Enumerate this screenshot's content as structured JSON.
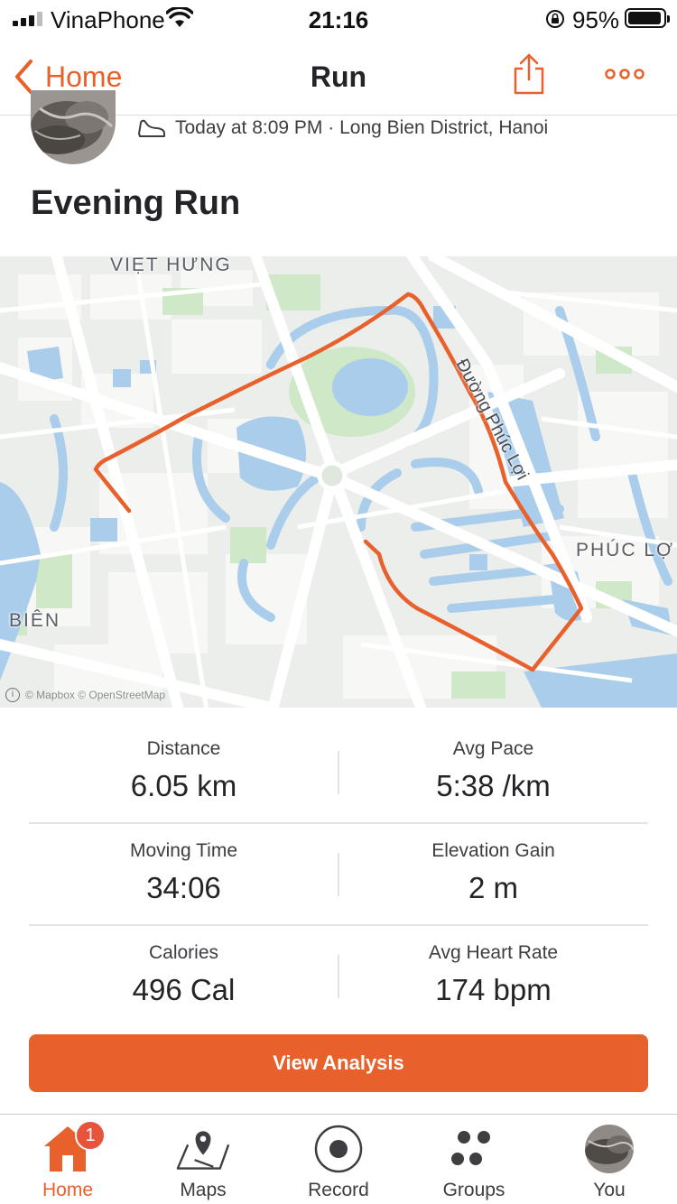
{
  "status_bar": {
    "carrier": "VinaPhone",
    "time": "21:16",
    "battery": "95%",
    "battery_level": 0.95
  },
  "nav": {
    "back_label": "Home",
    "title": "Run"
  },
  "activity": {
    "meta": "Today at 8:09 PM · Long Bien District, Hanoi",
    "title": "Evening Run"
  },
  "map": {
    "labels": {
      "viet_hung": "VIỆT HƯNG",
      "phuc_loi": "PHÚC LỢ",
      "bien": "BIÊN",
      "duong_phuc_loi": "Đường Phúc Lợi"
    },
    "attribution": "© Mapbox © OpenStreetMap",
    "route_color": "#e8612c"
  },
  "stats": [
    {
      "label": "Distance",
      "value": "6.05 km"
    },
    {
      "label": "Avg Pace",
      "value": "5:38 /km"
    },
    {
      "label": "Moving Time",
      "value": "34:06"
    },
    {
      "label": "Elevation Gain",
      "value": "2 m"
    },
    {
      "label": "Calories",
      "value": "496 Cal"
    },
    {
      "label": "Avg Heart Rate",
      "value": "174 bpm"
    }
  ],
  "view_analysis_label": "View Analysis",
  "tabs": [
    {
      "label": "Home",
      "icon": "home-icon",
      "badge": "1"
    },
    {
      "label": "Maps",
      "icon": "map-pin-icon"
    },
    {
      "label": "Record",
      "icon": "record-icon"
    },
    {
      "label": "Groups",
      "icon": "groups-icon"
    },
    {
      "label": "You",
      "icon": "profile-avatar"
    }
  ],
  "colors": {
    "accent": "#e8612c",
    "badge": "#e8533c",
    "water": "#a9cdea",
    "park": "#cfe8c8"
  }
}
